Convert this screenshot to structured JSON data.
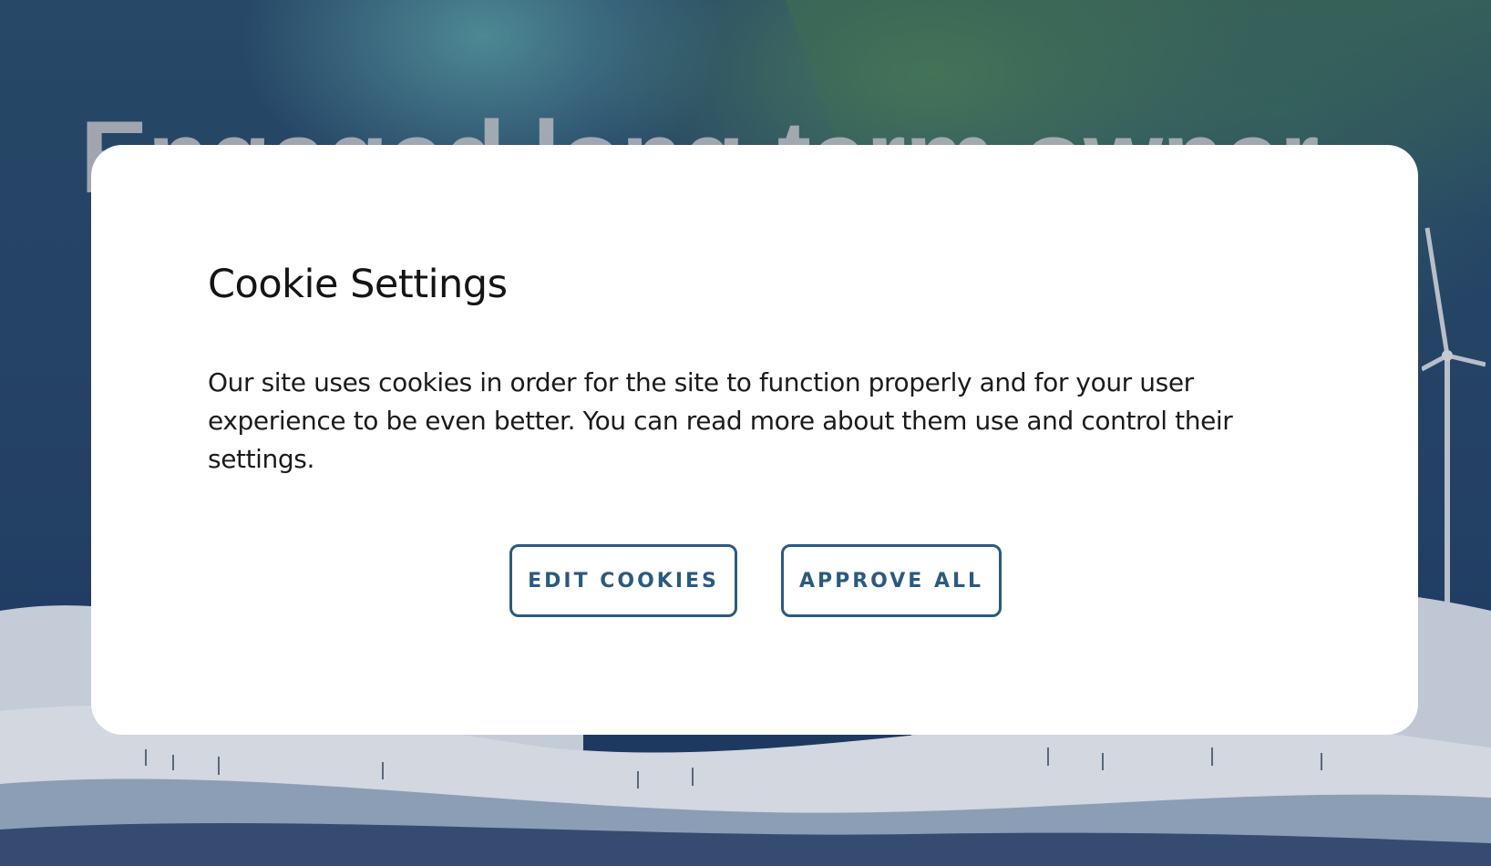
{
  "background": {
    "hero_title": "Engaged long-term owner",
    "colors": {
      "sky": "#2a4a6c",
      "aurora_teal": "#5fa5aa",
      "aurora_green": "#558c5f",
      "snow": "#e6ebf2"
    }
  },
  "cookie_modal": {
    "title": "Cookie Settings",
    "description": "Our site uses cookies in order for the site to function properly and for your user experience to be even better. You can read more about them use and control their settings.",
    "edit_button_label": "EDIT COOKIES",
    "approve_button_label": "APPROVE ALL",
    "accent_color": "#2b5a80"
  }
}
